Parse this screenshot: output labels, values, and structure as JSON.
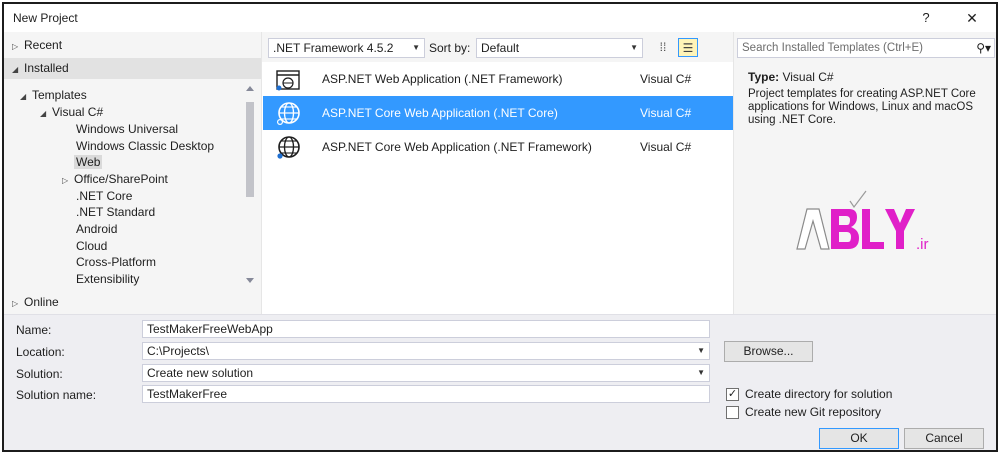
{
  "window": {
    "title": "New Project",
    "help_label": "?",
    "close_label": "✕"
  },
  "left_pane": {
    "recent": "Recent",
    "installed": "Installed",
    "templates": "Templates",
    "visual_csharp": "Visual C#",
    "children": [
      "Windows Universal",
      "Windows Classic Desktop",
      "Web",
      "Office/SharePoint",
      ".NET Core",
      ".NET Standard",
      "Android",
      "Cloud",
      "Cross-Platform",
      "Extensibility"
    ],
    "online": "Online"
  },
  "toolbar": {
    "framework": ".NET Framework 4.5.2",
    "sort_by_label": "Sort by:",
    "sort_value": "Default"
  },
  "templates": [
    {
      "name": "ASP.NET Web Application (.NET Framework)",
      "lang": "Visual C#",
      "icon": "web-application-icon"
    },
    {
      "name": "ASP.NET Core Web Application (.NET Core)",
      "lang": "Visual C#",
      "icon": "globe-icon"
    },
    {
      "name": "ASP.NET Core Web Application (.NET Framework)",
      "lang": "Visual C#",
      "icon": "globe-icon"
    }
  ],
  "details": {
    "search_placeholder": "Search Installed Templates (Ctrl+E)",
    "type_label": "Type:",
    "type_value": "Visual C#",
    "description": "Project templates for creating ASP.NET Core applications for Windows, Linux and macOS using .NET Core.",
    "logo_text": "ABLY",
    "logo_suffix": ".ir"
  },
  "form": {
    "name_label": "Name:",
    "name_value": "TestMakerFreeWebApp",
    "location_label": "Location:",
    "location_value": "C:\\Projects\\",
    "solution_label": "Solution:",
    "solution_value": "Create new solution",
    "solution_name_label": "Solution name:",
    "solution_name_value": "TestMakerFree",
    "browse_label": "Browse...",
    "create_dir_label": "Create directory for solution",
    "create_dir_checked": true,
    "git_label": "Create new Git repository",
    "git_checked": false,
    "ok_label": "OK",
    "cancel_label": "Cancel"
  },
  "colors": {
    "selection": "#3399ff",
    "logo_magenta": "#e020c8"
  }
}
